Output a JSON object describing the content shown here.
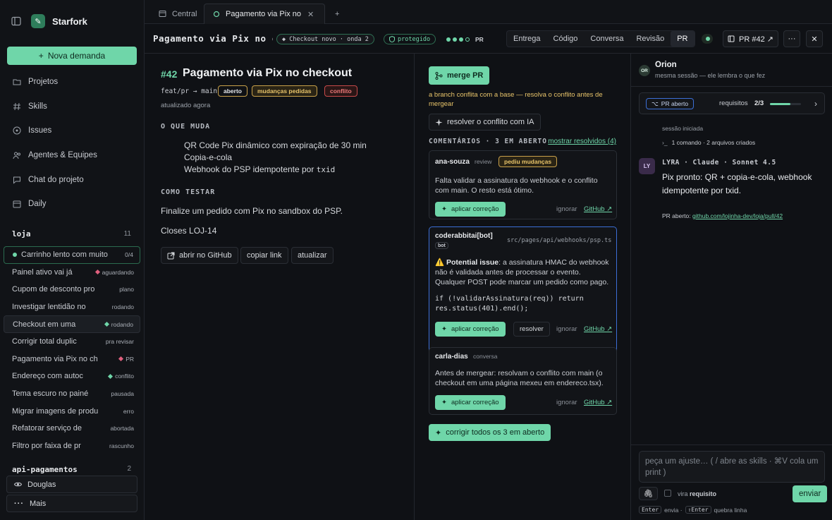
{
  "app": {
    "name": "Starfork",
    "new_label": "Nova demanda"
  },
  "nav": [
    {
      "label": "Projetos",
      "icon": "folder-icon"
    },
    {
      "label": "Skills",
      "icon": "hash-icon"
    },
    {
      "label": "Issues",
      "icon": "circle-dot-icon"
    },
    {
      "label": "Agentes & Equipes",
      "icon": "users-icon"
    },
    {
      "label": "Chat do projeto",
      "icon": "chat-icon"
    },
    {
      "label": "Daily",
      "icon": "calendar-icon"
    }
  ],
  "sections": {
    "loja": {
      "title": "loja",
      "count": "11"
    },
    "api": {
      "title": "api-pagamentos",
      "count": "2"
    }
  },
  "tasks": [
    {
      "label": "Carrinho lento com muito",
      "status": "0/4",
      "dot": "#6fd6a9"
    },
    {
      "label": "Painel ativo vai já",
      "status": "aguardando",
      "dot": "#e0607e"
    },
    {
      "label": "Cupom de desconto pro",
      "status": "plano",
      "dot": ""
    },
    {
      "label": "Investigar lentidão no",
      "status": "rodando",
      "dot": ""
    },
    {
      "label": "Checkout em uma",
      "status": "rodando",
      "dot": "#6fd6a9"
    },
    {
      "label": "Corrigir total duplic",
      "status": "pra revisar",
      "dot": ""
    },
    {
      "label": "Pagamento via Pix no ch",
      "status": "PR",
      "dot": "#e0607e"
    },
    {
      "label": "Endereço com autoc",
      "status": "conflito",
      "dot": "#6fd6a9"
    },
    {
      "label": "Tema escuro no painé",
      "status": "pausada",
      "dot": ""
    },
    {
      "label": "Migrar imagens de produ",
      "status": "erro",
      "dot": ""
    },
    {
      "label": "Refatorar serviço de",
      "status": "abortada",
      "dot": ""
    },
    {
      "label": "Filtro por faixa de pr",
      "status": "rascunho",
      "dot": ""
    }
  ],
  "bottom": {
    "user": "Douglas",
    "more": "Mais"
  },
  "tabs": {
    "central": "Central",
    "active": "Pagamento via Pix no che"
  },
  "header": {
    "title": "Pagamento via Pix no checkout",
    "branch_pill": "◆ Checkout novo · onda 2",
    "protected": "protegido",
    "pr_label": "PR",
    "views": [
      "Entrega",
      "Código",
      "Conversa",
      "Revisão",
      "PR"
    ],
    "pr_button": "PR #42 ↗"
  },
  "pr": {
    "number": "#42",
    "title": "Pagamento via Pix no checkout",
    "branch": "feat/pr → main",
    "badges": [
      "aberto",
      "mudanças pedidas",
      "conflito"
    ],
    "updated": "atualizado agora",
    "what_changes": "O QUE MUDA",
    "bullets": [
      "QR Code Pix dinâmico com expiração de 30 min",
      "Copia-e-cola",
      "Webhook do PSP idempotente por"
    ],
    "txid": "txid",
    "how_test": "COMO TESTAR",
    "test_text": "Finalize um pedido com Pix no sandbox do PSP.",
    "closes": "Closes LOJ-14",
    "actions": [
      "abrir no GitHub",
      "copiar link",
      "atualizar"
    ]
  },
  "review": {
    "merge": "merge PR",
    "conflict_msg": "a branch conflita com a base — resolva o conflito antes de mergear",
    "resolve_ai": "resolver o conflito com IA",
    "comments_label": "COMENTÁRIOS · 3 EM ABERTO",
    "show_resolved": "mostrar resolvidos (4)",
    "comments": [
      {
        "author": "ana-souza",
        "role": "review",
        "tag": "pediu mudanças",
        "text": "Falta validar a assinatura do webhook e o conflito com main. O resto está ótimo.",
        "apply": "aplicar correção",
        "ignore": "ignorar",
        "gh": "GitHub ↗"
      },
      {
        "author": "coderabbitai[bot]",
        "bot": "bot",
        "file": "src/pages/api/webhooks/psp.ts",
        "issue_title": "⚠️ Potential issue",
        "text": ": a assinatura HMAC do webhook não é validada antes de processar o evento. Qualquer POST pode marcar um pedido como pago.",
        "code": "if (!validarAssinatura(req)) return res.status(401).end();",
        "apply": "aplicar correção",
        "resolve": "resolver",
        "ignore": "ignorar",
        "gh": "GitHub ↗"
      },
      {
        "author": "carla-dias",
        "role": "conversa",
        "text": "Antes de mergear: resolvam o conflito com main (o checkout em uma página mexeu em endereco.tsx).",
        "apply": "aplicar correção",
        "ignore": "ignorar",
        "gh": "GitHub ↗"
      }
    ],
    "fix_all": "corrigir todos os 3 em aberto"
  },
  "agent": {
    "name": "Orion",
    "sub": "mesma sessão — ele lembra o que fez",
    "avatar": "OR",
    "pr_badge": "PR aberto",
    "req_label": "requisitos",
    "req_value": "2/3",
    "req_progress": 0.67,
    "session": "sessão iniciada",
    "cmd": "1 comando · 2 arquivos criados",
    "lyra_avatar": "LY",
    "lyra_model": "LYRA · Claude · Sonnet 4.5",
    "lyra_msg": "Pix pronto: QR + copia-e-cola, webhook idempotente por txid.",
    "pr_opened_label": "PR aberto:",
    "pr_link": "github.com/lojinha-dev/loja/pull/42",
    "composer_placeholder": "peça um ajuste… ( / abre as skills · ⌘V cola um print )",
    "vira_label": "vira",
    "vira_value": "requisito",
    "send": "enviar",
    "hint_enter": "Enter",
    "hint_sends": "envia ·",
    "hint_shift": "⇧Enter",
    "hint_newline": "quebra linha"
  }
}
